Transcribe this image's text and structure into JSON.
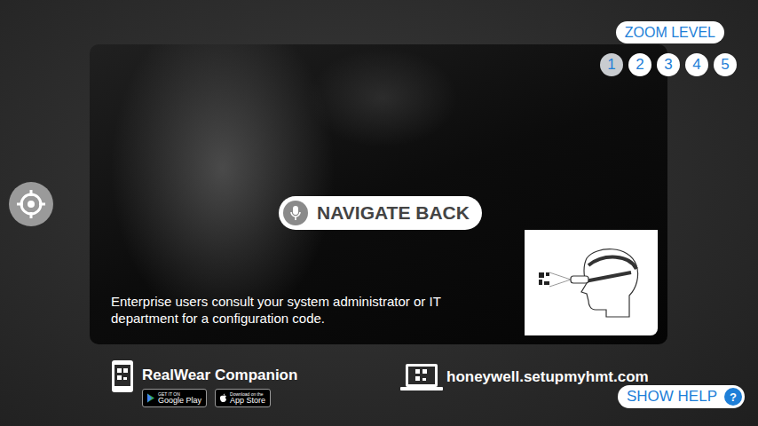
{
  "zoom": {
    "label": "ZOOM LEVEL",
    "levels": [
      {
        "label": "1",
        "selected": true
      },
      {
        "label": "2",
        "selected": false
      },
      {
        "label": "3",
        "selected": false
      },
      {
        "label": "4",
        "selected": false
      },
      {
        "label": "5",
        "selected": false
      }
    ]
  },
  "card": {
    "command": "NAVIGATE BACK",
    "message": "Enterprise users consult your system administrator or IT department for a configuration code."
  },
  "companion": {
    "title": "RealWear Companion",
    "stores": [
      {
        "kind": "google",
        "top": "GET IT ON",
        "name": "Google Play"
      },
      {
        "kind": "apple",
        "top": "Download on the",
        "name": "App Store"
      }
    ]
  },
  "setup": {
    "url": "honeywell.setupmyhmt.com"
  },
  "help": {
    "label": "SHOW HELP",
    "icon": "?"
  }
}
